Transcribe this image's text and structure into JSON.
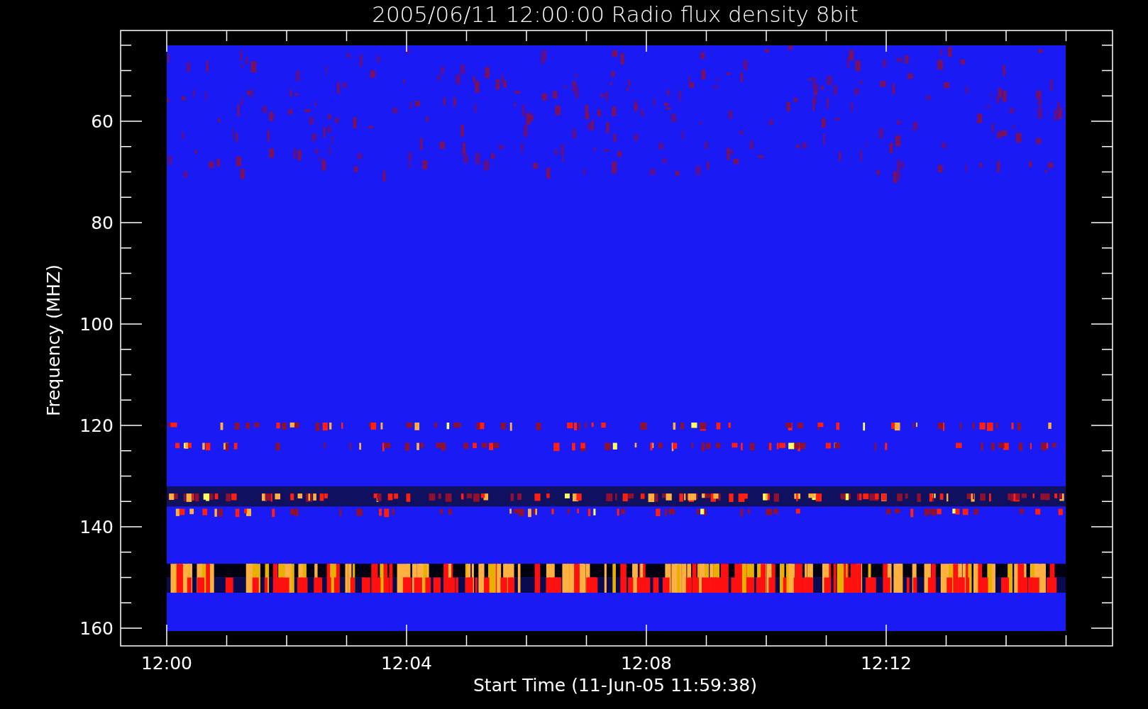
{
  "title": "2005/06/11 12:00:00 Radio flux density 8bit",
  "y_axis": {
    "label": "Frequency (MHZ)",
    "ticks": [
      "60",
      "80",
      "100",
      "120",
      "140",
      "160"
    ]
  },
  "x_axis": {
    "label": "Start Time (11-Jun-05 11:59:38)",
    "ticks": [
      "12:00",
      "12:04",
      "12:08",
      "12:12"
    ]
  }
}
